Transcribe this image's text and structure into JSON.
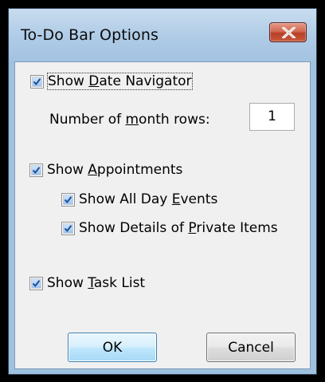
{
  "window": {
    "title": "To-Do Bar Options",
    "close_icon": "close-icon"
  },
  "options": {
    "date_navigator": {
      "before": "Show ",
      "key": "D",
      "after": "ate Navigator",
      "checked": true
    },
    "month_rows": {
      "before": "Number of ",
      "key": "m",
      "after": "onth rows:",
      "value": "1"
    },
    "appointments": {
      "before": "Show ",
      "key": "A",
      "after": "ppointments",
      "checked": true
    },
    "all_day_events": {
      "before": "Show All Day ",
      "key": "E",
      "after": "vents",
      "checked": true
    },
    "private_items": {
      "before": "Show Details of ",
      "key": "P",
      "after": "rivate Items",
      "checked": true
    },
    "task_list": {
      "before": "Show ",
      "key": "T",
      "after": "ask List",
      "checked": true
    }
  },
  "buttons": {
    "ok": "OK",
    "cancel": "Cancel"
  },
  "colors": {
    "accent_check": "#1f4e99",
    "close_red": "#c75a3f",
    "title_blue": "#a4c3e1"
  }
}
